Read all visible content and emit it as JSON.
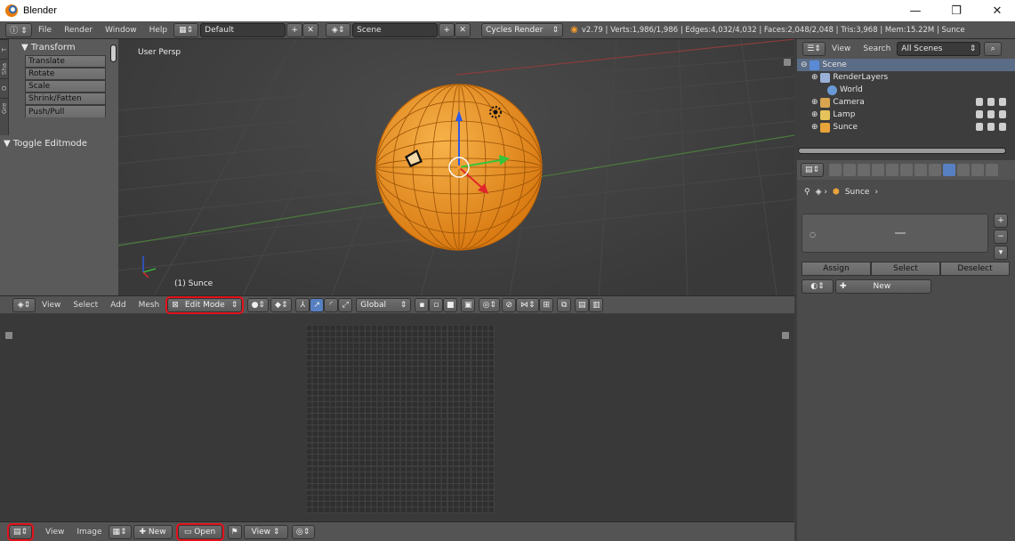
{
  "window": {
    "title": "Blender",
    "minimize": "—",
    "maximize": "❐",
    "close": "✕"
  },
  "info_header": {
    "menus": [
      "File",
      "Render",
      "Window",
      "Help"
    ],
    "layout": "Default",
    "scene": "Scene",
    "engine": "Cycles Render",
    "stats": "v2.79 | Verts:1,986/1,986 | Edges:4,032/4,032 | Faces:2,048/2,048 | Tris:3,968 | Mem:15.22M | Sunce"
  },
  "tool_shelf": {
    "tabs": [
      "T",
      "Sha",
      "O",
      "Gre"
    ],
    "transform_title": "▼ Transform",
    "tools": [
      "Translate",
      "Rotate",
      "Scale",
      "Shrink/Fatten",
      "Push/Pull"
    ],
    "toggle_editmode": "▼ Toggle Editmode"
  },
  "viewport": {
    "view_label": "User Persp",
    "object_label": "(1) Sunce",
    "header_menus": [
      "View",
      "Select",
      "Add",
      "Mesh"
    ],
    "mode": "Edit Mode",
    "orientation": "Global"
  },
  "uv_editor": {
    "header_menus": [
      "View",
      "Image"
    ],
    "new_label": "New",
    "open_label": "Open",
    "view_label": "View"
  },
  "outliner": {
    "view_label": "View",
    "search_label": "Search",
    "filter": "All Scenes",
    "items": [
      {
        "label": "Scene",
        "indent": 0,
        "color": "#5a8ad6"
      },
      {
        "label": "RenderLayers",
        "indent": 1,
        "color": "#9ab0d8"
      },
      {
        "label": "World",
        "indent": 2,
        "color": "#6a9ad6"
      },
      {
        "label": "Camera",
        "indent": 1,
        "color": "#d8a450"
      },
      {
        "label": "Lamp",
        "indent": 1,
        "color": "#e6c35a"
      },
      {
        "label": "Sunce",
        "indent": 1,
        "color": "#e8a33a"
      }
    ]
  },
  "properties": {
    "object_name": "Sunce",
    "assign": "Assign",
    "select": "Select",
    "deselect": "Deselect",
    "new_label": "New"
  },
  "colors": {
    "accent_orange": "#f5a623",
    "highlight_red": "#e4121d",
    "selection_blue": "#5b6c86"
  }
}
